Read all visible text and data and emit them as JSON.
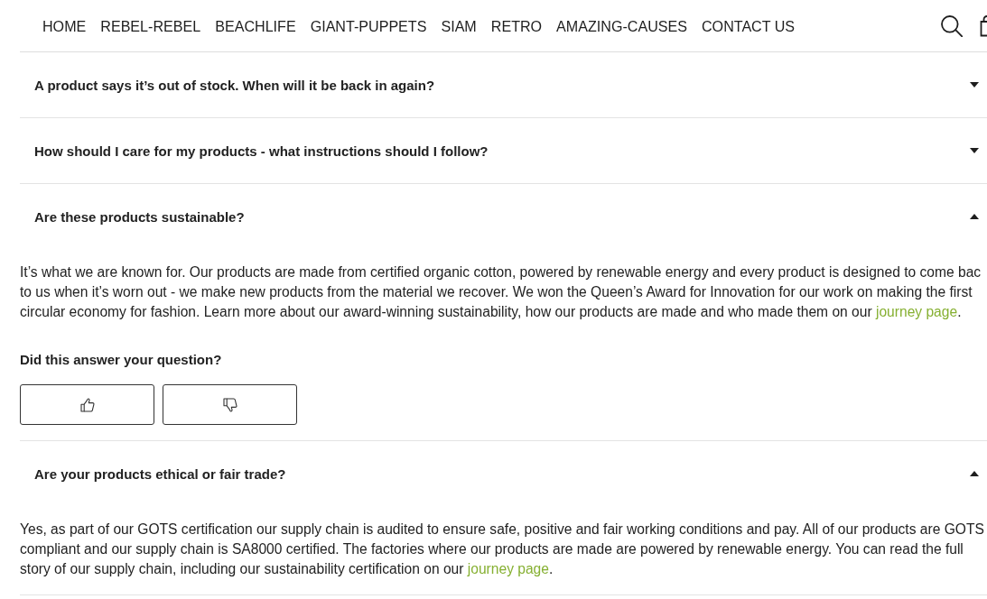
{
  "nav": {
    "items": [
      "HOME",
      "REBEL-REBEL",
      "BEACHLIFE",
      "GIANT-PUPPETS",
      "SIAM",
      "RETRO",
      "AMAZING-CAUSES",
      "CONTACT US"
    ]
  },
  "faq": [
    {
      "question": "A product says it’s out of stock. When will it be back in again?",
      "expanded": false
    },
    {
      "question": "How should I care for my products - what instructions should I follow?",
      "expanded": false
    },
    {
      "question": "Are these products sustainable?",
      "expanded": true,
      "answer": {
        "lines": [
          "It’s what we are known for. Our products are made from certified organic cotton, powered by renewable energy and every product is designed to come bac",
          "to us when it’s worn out - we make new products from the material we recover. We won the Queen’s Award for Innovation for our work on making the first",
          "circular economy for fashion. Learn more about our award-winning sustainability, how our products are made and who made them on our "
        ],
        "link": "journey page",
        "tail": "."
      },
      "feedback": {
        "prompt": "Did this answer your question?"
      }
    },
    {
      "question": "Are your products ethical or fair trade?",
      "expanded": true,
      "answer": {
        "lines": [
          "Yes, as part of our GOTS certification our supply chain is audited to ensure safe, positive and fair working conditions and pay. All of our products are GOTS",
          "compliant and our supply chain is SA8000 certified. The factories where our products are made are powered by renewable energy. You can read the full",
          "story of our supply chain, including our sustainability certification on our "
        ],
        "link": "journey page",
        "tail": "."
      }
    }
  ]
}
